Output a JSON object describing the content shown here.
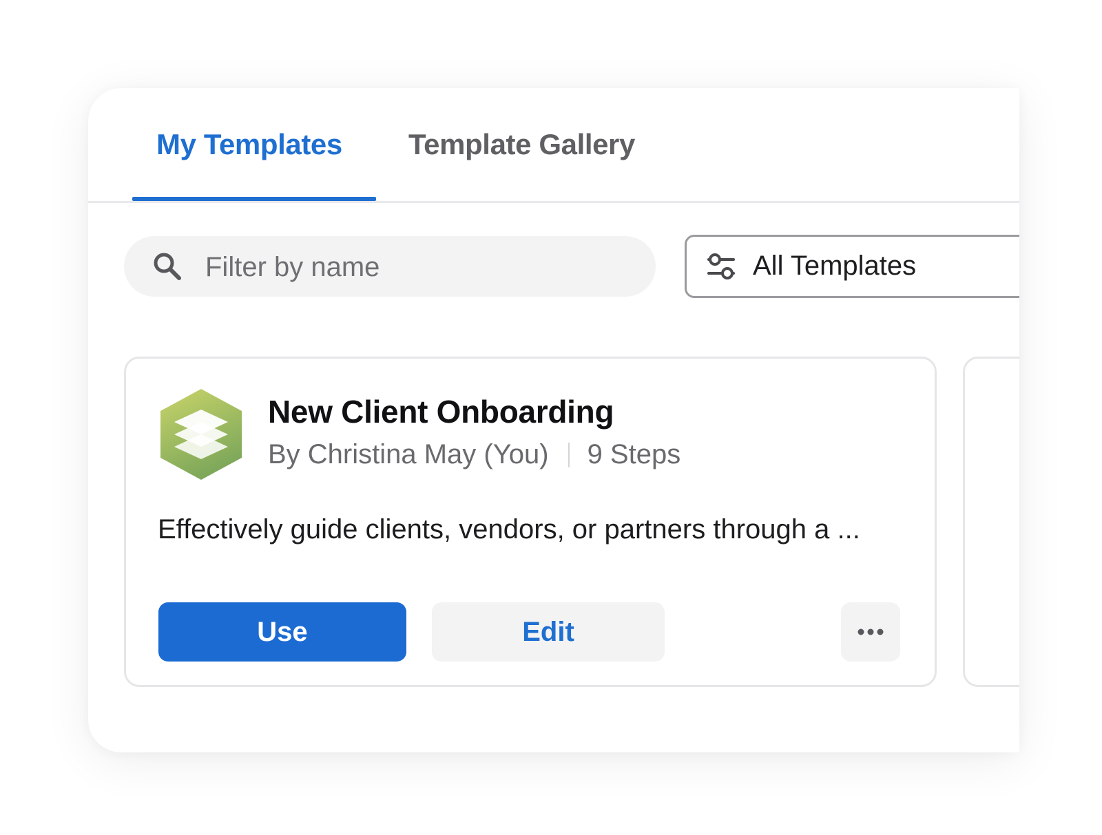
{
  "tabs": [
    {
      "label": "My Templates",
      "active": true
    },
    {
      "label": "Template Gallery",
      "active": false
    }
  ],
  "search": {
    "placeholder": "Filter by name",
    "value": "",
    "icon": "search-icon"
  },
  "filter": {
    "selected": "All Templates",
    "icon": "sliders-icon"
  },
  "card": {
    "title": "New Client Onboarding",
    "author": "By Christina May (You)",
    "steps": "9 Steps",
    "description": "Effectively guide clients, vendors, or partners through a ...",
    "icon": "stacked-layers-icon",
    "use_label": "Use",
    "edit_label": "Edit",
    "more_icon": "more-horizontal-icon"
  },
  "colors": {
    "accent": "#1f6fd1",
    "primary_button": "#1b6bd3",
    "secondary_button": "#f3f3f4",
    "logo_light": "#c9d46a",
    "logo_dark": "#7ea85a"
  }
}
